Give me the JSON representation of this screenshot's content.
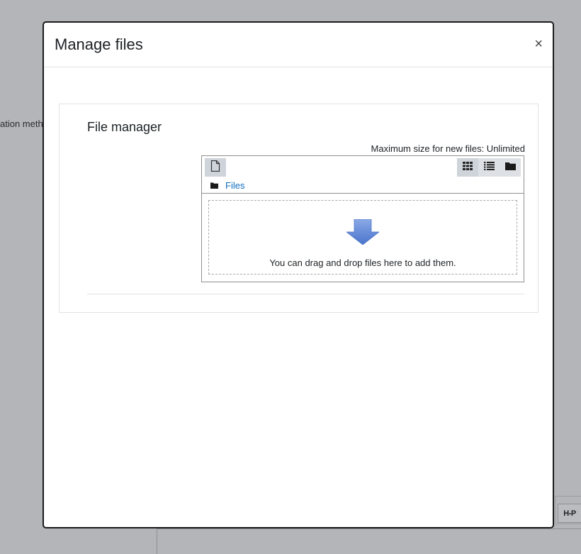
{
  "backdrop": {
    "left_text": "ation meth",
    "h5p_label": "H-P"
  },
  "modal": {
    "title": "Manage files",
    "close_label": "×"
  },
  "file_manager": {
    "heading": "File manager",
    "max_size_text": "Maximum size for new files: Unlimited",
    "path_link": "Files",
    "drop_text": "You can drag and drop files here to add them.",
    "toolbar": {
      "add_icon": "file-icon",
      "view_icons": "grid-icon",
      "view_list": "list-icon",
      "view_tree": "folder-icon",
      "active_view": "icons"
    }
  },
  "colors": {
    "link": "#0f6cbf",
    "backdrop": "#b3b5b8",
    "arrow": "#5b86d6"
  }
}
